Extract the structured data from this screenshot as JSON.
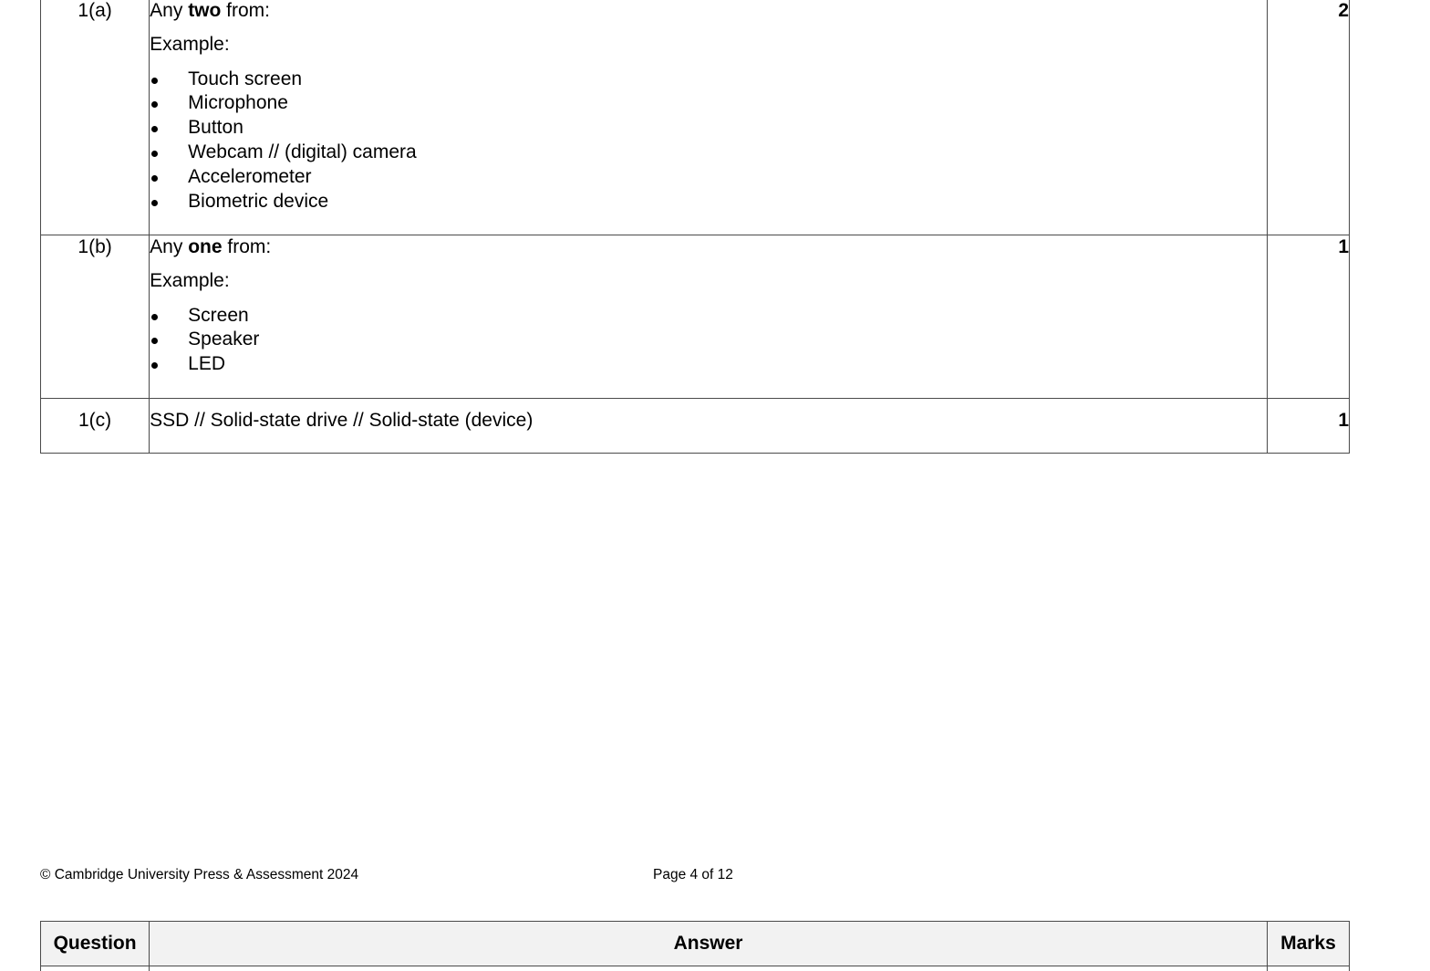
{
  "rows": [
    {
      "question": "1(a)",
      "instruction": {
        "prefix": "Any ",
        "emphasis": "two",
        "suffix": " from:"
      },
      "example_label": "Example:",
      "bullets": [
        "Touch screen",
        "Microphone",
        "Button",
        "Webcam // (digital) camera",
        "Accelerometer",
        "Biometric device"
      ],
      "marks": "2"
    },
    {
      "question": "1(b)",
      "instruction": {
        "prefix": "Any ",
        "emphasis": "one",
        "suffix": " from:"
      },
      "example_label": "Example:",
      "bullets": [
        "Screen",
        "Speaker",
        "LED"
      ],
      "marks": "1"
    },
    {
      "question": "1(c)",
      "answer": "SSD // Solid-state drive // Solid-state (device)",
      "marks": "1"
    }
  ],
  "footer": {
    "copyright": "© Cambridge University Press & Assessment 2024",
    "page": "Page 4 of 12"
  },
  "next_table_header": {
    "question": "Question",
    "answer": "Answer",
    "marks": "Marks"
  }
}
